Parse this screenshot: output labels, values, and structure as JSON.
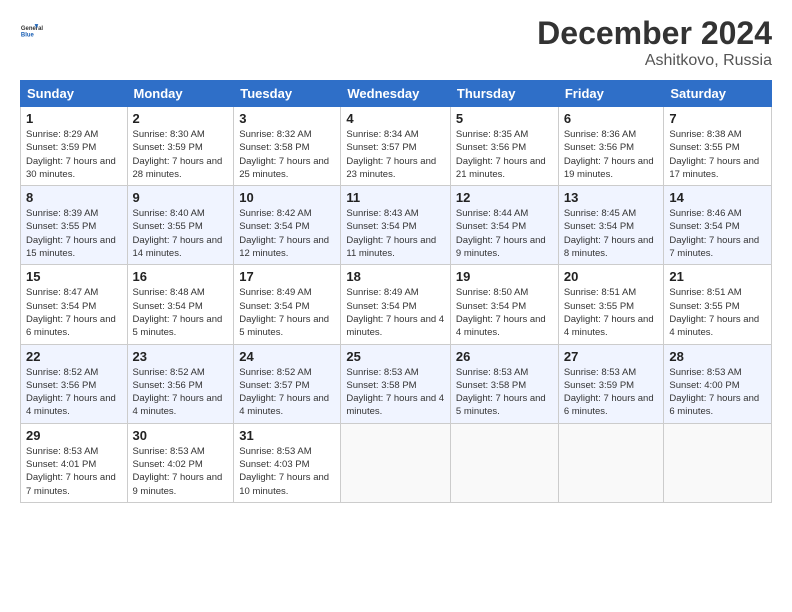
{
  "logo": {
    "line1": "General",
    "line2": "Blue"
  },
  "title": "December 2024",
  "location": "Ashitkovo, Russia",
  "weekdays": [
    "Sunday",
    "Monday",
    "Tuesday",
    "Wednesday",
    "Thursday",
    "Friday",
    "Saturday"
  ],
  "weeks": [
    [
      {
        "day": "1",
        "sunrise": "Sunrise: 8:29 AM",
        "sunset": "Sunset: 3:59 PM",
        "daylight": "Daylight: 7 hours and 30 minutes."
      },
      {
        "day": "2",
        "sunrise": "Sunrise: 8:30 AM",
        "sunset": "Sunset: 3:59 PM",
        "daylight": "Daylight: 7 hours and 28 minutes."
      },
      {
        "day": "3",
        "sunrise": "Sunrise: 8:32 AM",
        "sunset": "Sunset: 3:58 PM",
        "daylight": "Daylight: 7 hours and 25 minutes."
      },
      {
        "day": "4",
        "sunrise": "Sunrise: 8:34 AM",
        "sunset": "Sunset: 3:57 PM",
        "daylight": "Daylight: 7 hours and 23 minutes."
      },
      {
        "day": "5",
        "sunrise": "Sunrise: 8:35 AM",
        "sunset": "Sunset: 3:56 PM",
        "daylight": "Daylight: 7 hours and 21 minutes."
      },
      {
        "day": "6",
        "sunrise": "Sunrise: 8:36 AM",
        "sunset": "Sunset: 3:56 PM",
        "daylight": "Daylight: 7 hours and 19 minutes."
      },
      {
        "day": "7",
        "sunrise": "Sunrise: 8:38 AM",
        "sunset": "Sunset: 3:55 PM",
        "daylight": "Daylight: 7 hours and 17 minutes."
      }
    ],
    [
      {
        "day": "8",
        "sunrise": "Sunrise: 8:39 AM",
        "sunset": "Sunset: 3:55 PM",
        "daylight": "Daylight: 7 hours and 15 minutes."
      },
      {
        "day": "9",
        "sunrise": "Sunrise: 8:40 AM",
        "sunset": "Sunset: 3:55 PM",
        "daylight": "Daylight: 7 hours and 14 minutes."
      },
      {
        "day": "10",
        "sunrise": "Sunrise: 8:42 AM",
        "sunset": "Sunset: 3:54 PM",
        "daylight": "Daylight: 7 hours and 12 minutes."
      },
      {
        "day": "11",
        "sunrise": "Sunrise: 8:43 AM",
        "sunset": "Sunset: 3:54 PM",
        "daylight": "Daylight: 7 hours and 11 minutes."
      },
      {
        "day": "12",
        "sunrise": "Sunrise: 8:44 AM",
        "sunset": "Sunset: 3:54 PM",
        "daylight": "Daylight: 7 hours and 9 minutes."
      },
      {
        "day": "13",
        "sunrise": "Sunrise: 8:45 AM",
        "sunset": "Sunset: 3:54 PM",
        "daylight": "Daylight: 7 hours and 8 minutes."
      },
      {
        "day": "14",
        "sunrise": "Sunrise: 8:46 AM",
        "sunset": "Sunset: 3:54 PM",
        "daylight": "Daylight: 7 hours and 7 minutes."
      }
    ],
    [
      {
        "day": "15",
        "sunrise": "Sunrise: 8:47 AM",
        "sunset": "Sunset: 3:54 PM",
        "daylight": "Daylight: 7 hours and 6 minutes."
      },
      {
        "day": "16",
        "sunrise": "Sunrise: 8:48 AM",
        "sunset": "Sunset: 3:54 PM",
        "daylight": "Daylight: 7 hours and 5 minutes."
      },
      {
        "day": "17",
        "sunrise": "Sunrise: 8:49 AM",
        "sunset": "Sunset: 3:54 PM",
        "daylight": "Daylight: 7 hours and 5 minutes."
      },
      {
        "day": "18",
        "sunrise": "Sunrise: 8:49 AM",
        "sunset": "Sunset: 3:54 PM",
        "daylight": "Daylight: 7 hours and 4 minutes."
      },
      {
        "day": "19",
        "sunrise": "Sunrise: 8:50 AM",
        "sunset": "Sunset: 3:54 PM",
        "daylight": "Daylight: 7 hours and 4 minutes."
      },
      {
        "day": "20",
        "sunrise": "Sunrise: 8:51 AM",
        "sunset": "Sunset: 3:55 PM",
        "daylight": "Daylight: 7 hours and 4 minutes."
      },
      {
        "day": "21",
        "sunrise": "Sunrise: 8:51 AM",
        "sunset": "Sunset: 3:55 PM",
        "daylight": "Daylight: 7 hours and 4 minutes."
      }
    ],
    [
      {
        "day": "22",
        "sunrise": "Sunrise: 8:52 AM",
        "sunset": "Sunset: 3:56 PM",
        "daylight": "Daylight: 7 hours and 4 minutes."
      },
      {
        "day": "23",
        "sunrise": "Sunrise: 8:52 AM",
        "sunset": "Sunset: 3:56 PM",
        "daylight": "Daylight: 7 hours and 4 minutes."
      },
      {
        "day": "24",
        "sunrise": "Sunrise: 8:52 AM",
        "sunset": "Sunset: 3:57 PM",
        "daylight": "Daylight: 7 hours and 4 minutes."
      },
      {
        "day": "25",
        "sunrise": "Sunrise: 8:53 AM",
        "sunset": "Sunset: 3:58 PM",
        "daylight": "Daylight: 7 hours and 4 minutes."
      },
      {
        "day": "26",
        "sunrise": "Sunrise: 8:53 AM",
        "sunset": "Sunset: 3:58 PM",
        "daylight": "Daylight: 7 hours and 5 minutes."
      },
      {
        "day": "27",
        "sunrise": "Sunrise: 8:53 AM",
        "sunset": "Sunset: 3:59 PM",
        "daylight": "Daylight: 7 hours and 6 minutes."
      },
      {
        "day": "28",
        "sunrise": "Sunrise: 8:53 AM",
        "sunset": "Sunset: 4:00 PM",
        "daylight": "Daylight: 7 hours and 6 minutes."
      }
    ],
    [
      {
        "day": "29",
        "sunrise": "Sunrise: 8:53 AM",
        "sunset": "Sunset: 4:01 PM",
        "daylight": "Daylight: 7 hours and 7 minutes."
      },
      {
        "day": "30",
        "sunrise": "Sunrise: 8:53 AM",
        "sunset": "Sunset: 4:02 PM",
        "daylight": "Daylight: 7 hours and 9 minutes."
      },
      {
        "day": "31",
        "sunrise": "Sunrise: 8:53 AM",
        "sunset": "Sunset: 4:03 PM",
        "daylight": "Daylight: 7 hours and 10 minutes."
      },
      null,
      null,
      null,
      null
    ]
  ]
}
